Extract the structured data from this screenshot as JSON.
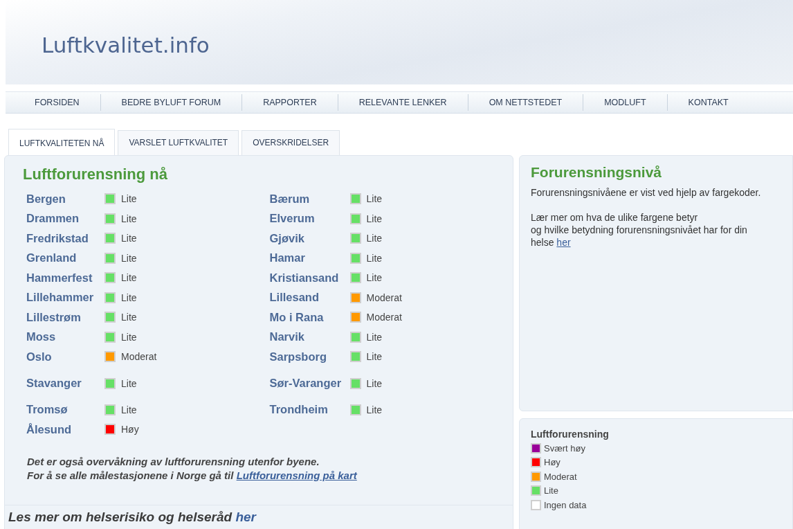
{
  "site": {
    "logo": "Luftkvalitet.info"
  },
  "nav": [
    "FORSIDEN",
    "BEDRE BYLUFT FORUM",
    "RAPPORTER",
    "RELEVANTE LENKER",
    "OM NETTSTEDET",
    "MODLUFT",
    "KONTAKT"
  ],
  "tabs": [
    {
      "label": "LUFTKVALITETEN NÅ",
      "selected": true
    },
    {
      "label": "VARSLET LUFTKVALITET",
      "selected": false
    },
    {
      "label": "OVERSKRIDELSER",
      "selected": false
    }
  ],
  "main": {
    "title": "Luftforurensning nå",
    "columns": [
      [
        {
          "city": "Bergen",
          "level": "Lite",
          "color": "#66e066"
        },
        {
          "city": "Drammen",
          "level": "Lite",
          "color": "#66e066"
        },
        {
          "city": "Fredrikstad",
          "level": "Lite",
          "color": "#66e066"
        },
        {
          "city": "Grenland",
          "level": "Lite",
          "color": "#66e066"
        },
        {
          "city": "Hammerfest",
          "level": "Lite",
          "color": "#66e066"
        },
        {
          "city": "Lillehammer",
          "level": "Lite",
          "color": "#66e066"
        },
        {
          "city": "Lillestrøm",
          "level": "Lite",
          "color": "#66e066"
        },
        {
          "city": "Moss",
          "level": "Lite",
          "color": "#66e066"
        },
        {
          "city": "Oslo",
          "level": "Moderat",
          "color": "#ff9900"
        },
        {
          "city": "Stavanger",
          "level": "Lite",
          "color": "#66e066"
        },
        {
          "city": "Tromsø",
          "level": "Lite",
          "color": "#66e066"
        },
        {
          "city": "Ålesund",
          "level": "Høy",
          "color": "#ff0000"
        }
      ],
      [
        {
          "city": "Bærum",
          "level": "Lite",
          "color": "#66e066"
        },
        {
          "city": "Elverum",
          "level": "Lite",
          "color": "#66e066"
        },
        {
          "city": "Gjøvik",
          "level": "Lite",
          "color": "#66e066"
        },
        {
          "city": "Hamar",
          "level": "Lite",
          "color": "#66e066"
        },
        {
          "city": "Kristiansand",
          "level": "Lite",
          "color": "#66e066"
        },
        {
          "city": "Lillesand",
          "level": "Moderat",
          "color": "#ff9900"
        },
        {
          "city": "Mo i Rana",
          "level": "Moderat",
          "color": "#ff9900"
        },
        {
          "city": "Narvik",
          "level": "Lite",
          "color": "#66e066"
        },
        {
          "city": "Sarpsborg",
          "level": "Lite",
          "color": "#66e066"
        },
        {
          "city": "Sør-Varanger",
          "level": "Lite",
          "color": "#66e066"
        },
        {
          "city": "Trondheim",
          "level": "Lite",
          "color": "#66e066"
        }
      ]
    ],
    "note_line_1": "Det er også overvåkning av luftforurensning utenfor byene.",
    "note_line_2": "For å se alle målestasjonene i Norge gå til",
    "note_link": "Luftforurensning på kart",
    "footer_text": "Les mer om helserisiko og helseråd",
    "footer_link": "her"
  },
  "info": {
    "title": "Forurensningsnivå",
    "paragraph_1": "Forurensningsnivåene er vist ved hjelp av fargekoder.",
    "paragraph_2_line_1": "Lær mer om hva de ulike fargene betyr",
    "paragraph_2_line_2": "og hvilke betydning forurensningsnivået har for din helse",
    "link": "her"
  },
  "legend": {
    "title": "Luftforurensning",
    "items": [
      {
        "label": "Svært høy",
        "color": "#990099"
      },
      {
        "label": "Høy",
        "color": "#ff0000"
      },
      {
        "label": "Moderat",
        "color": "#ff9900"
      },
      {
        "label": "Lite",
        "color": "#66e066"
      },
      {
        "label": "Ingen data",
        "color": "#ffffff"
      }
    ]
  }
}
